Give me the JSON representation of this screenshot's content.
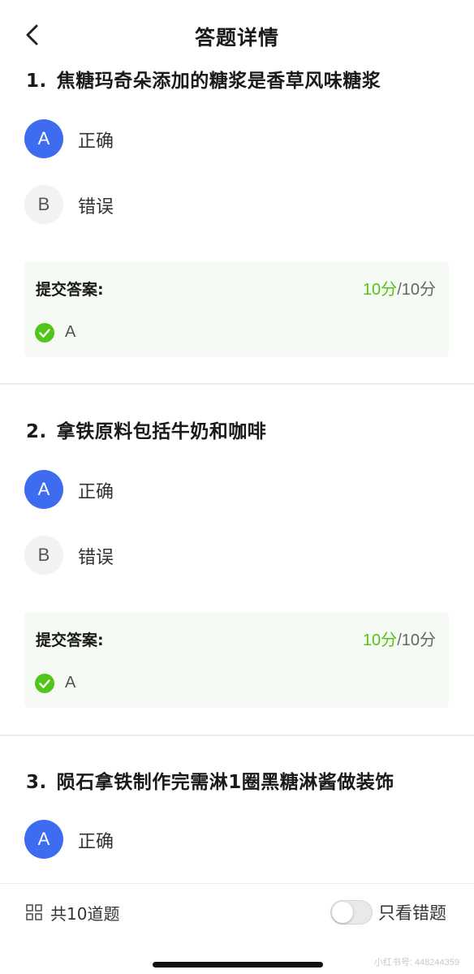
{
  "header": {
    "title": "答题详情"
  },
  "answer_label": "提交答案:",
  "questions": [
    {
      "number": "1.",
      "text": "焦糖玛奇朵添加的糖浆是香草风味糖浆",
      "options": [
        {
          "letter": "A",
          "label": "正确",
          "selected": true
        },
        {
          "letter": "B",
          "label": "错误",
          "selected": false
        }
      ],
      "score_got": "10分",
      "score_total": "/10分",
      "submitted": "A"
    },
    {
      "number": "2.",
      "text": "拿铁原料包括牛奶和咖啡",
      "options": [
        {
          "letter": "A",
          "label": "正确",
          "selected": true
        },
        {
          "letter": "B",
          "label": "错误",
          "selected": false
        }
      ],
      "score_got": "10分",
      "score_total": "/10分",
      "submitted": "A"
    },
    {
      "number": "3.",
      "text": "陨石拿铁制作完需淋1圈黑糖淋酱做装饰",
      "options": [
        {
          "letter": "A",
          "label": "正确",
          "selected": true
        }
      ]
    }
  ],
  "bottom_bar": {
    "count_label": "共10道题",
    "toggle_label": "只看错题",
    "toggle_on": false,
    "watermark": "小红书号: 448244359"
  },
  "icons": {
    "back": "chevron-left-icon",
    "check": "check-circle-icon",
    "grid": "grid-icon"
  },
  "colors": {
    "accent_blue": "#3d6cf0",
    "success_green": "#52c41a",
    "answer_bg": "#f6faf4"
  }
}
